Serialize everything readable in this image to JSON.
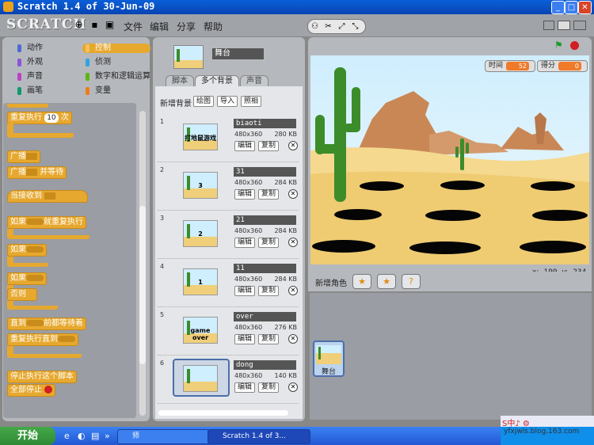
{
  "window": {
    "title": "Scratch 1.4 of 30-Jun-09"
  },
  "menu": {
    "logo": "SCRATCH",
    "items": [
      "文件",
      "编辑",
      "分享",
      "帮助"
    ]
  },
  "categories": [
    {
      "label": "动作",
      "color": "#4a6cd4"
    },
    {
      "label": "控制",
      "color": "#e6a82e"
    },
    {
      "label": "外观",
      "color": "#8a55d7"
    },
    {
      "label": "侦测",
      "color": "#2ca5e2"
    },
    {
      "label": "声音",
      "color": "#bb42c3"
    },
    {
      "label": "数字和逻辑运算",
      "color": "#5cb712"
    },
    {
      "label": "画笔",
      "color": "#0e9a6c"
    },
    {
      "label": "变量",
      "color": "#ee7d16"
    }
  ],
  "blocks": {
    "repeat": "重复执行",
    "repeat_n": "10",
    "repeat_unit": "次",
    "broadcast": "广播",
    "broadcast_wait": "广播",
    "broadcast_wait_suffix": "并等待",
    "when_receive": "当接收到",
    "if_forever": "如果",
    "if_forever_suffix": "就重复执行",
    "if": "如果",
    "ifelse": "如果",
    "else": "否则",
    "wait_until": "直到",
    "wait_until_suffix": "前都等待着",
    "repeat_until": "重复执行直到",
    "stop_script": "停止执行这个脚本",
    "stop_all": "全部停止"
  },
  "sprite": {
    "name": "舞台"
  },
  "tabs": [
    "脚本",
    "多个背景",
    "声音"
  ],
  "costumes_header": {
    "label": "新增背景",
    "paint": "绘图",
    "import": "导入",
    "camera": "照相"
  },
  "costumes": [
    {
      "num": "1",
      "name": "biaoti",
      "res": "480x360",
      "size": "280 KB",
      "thumb_text": "打地鼠游戏"
    },
    {
      "num": "2",
      "name": "31",
      "res": "480x360",
      "size": "284 KB",
      "thumb_text": "3"
    },
    {
      "num": "3",
      "name": "21",
      "res": "480x360",
      "size": "284 KB",
      "thumb_text": "2"
    },
    {
      "num": "4",
      "name": "11",
      "res": "480x360",
      "size": "284 KB",
      "thumb_text": "1"
    },
    {
      "num": "5",
      "name": "over",
      "res": "480x360",
      "size": "276 KB",
      "thumb_text": "game over"
    },
    {
      "num": "6",
      "name": "dong",
      "res": "480x360",
      "size": "140 KB",
      "thumb_text": ""
    }
  ],
  "costume_buttons": {
    "edit": "编辑",
    "copy": "复制"
  },
  "monitors": [
    {
      "label": "时间",
      "value": "52"
    },
    {
      "label": "得分",
      "value": "0"
    }
  ],
  "coords": {
    "x": "x: -199",
    "y": "y: -234"
  },
  "sprites_header": {
    "label": "新增角色"
  },
  "stage_thumb": {
    "label": "舞台"
  },
  "taskbar": {
    "start": "开始",
    "folder": "师",
    "task": "Scratch 1.4 of 3..."
  },
  "watermark": "yfxjwls.blog.163.com"
}
